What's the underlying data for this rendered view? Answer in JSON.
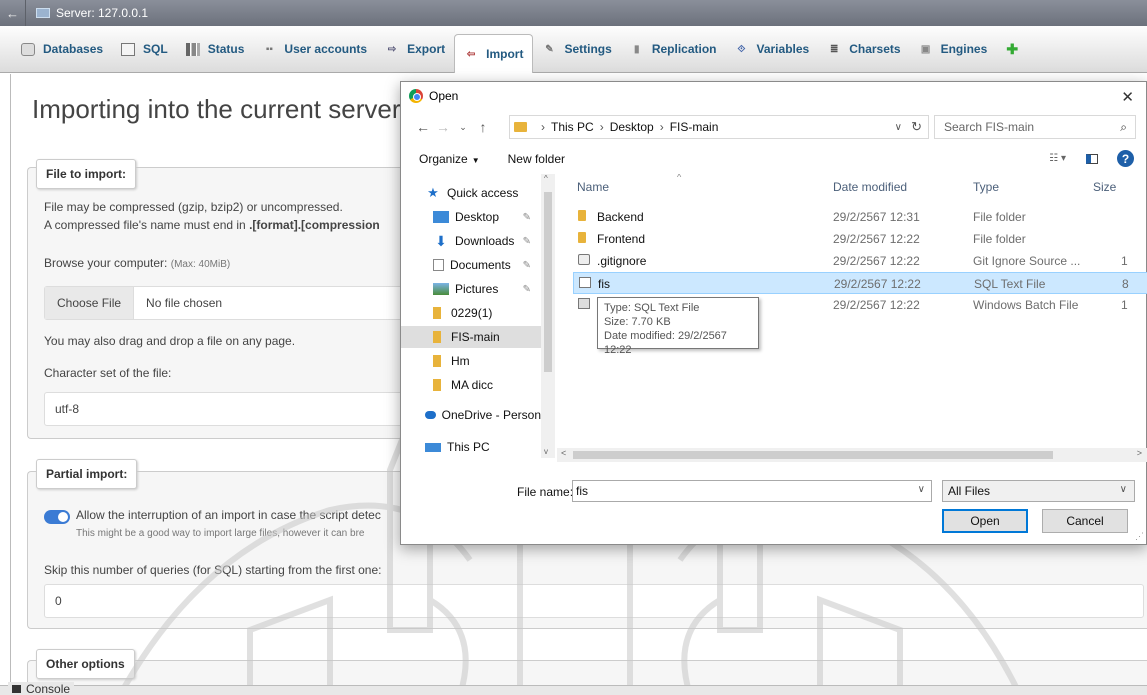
{
  "server_bar": {
    "title": "Server: 127.0.0.1"
  },
  "tabs": [
    {
      "label": "Databases",
      "icon": "database-icon"
    },
    {
      "label": "SQL",
      "icon": "sql-icon"
    },
    {
      "label": "Status",
      "icon": "status-icon"
    },
    {
      "label": "User accounts",
      "icon": "users-icon"
    },
    {
      "label": "Export",
      "icon": "export-icon"
    },
    {
      "label": "Import",
      "icon": "import-icon",
      "active": true
    },
    {
      "label": "Settings",
      "icon": "wrench-icon"
    },
    {
      "label": "Replication",
      "icon": "replication-icon"
    },
    {
      "label": "Variables",
      "icon": "variables-icon"
    },
    {
      "label": "Charsets",
      "icon": "charsets-icon"
    },
    {
      "label": "Engines",
      "icon": "engines-icon"
    }
  ],
  "main": {
    "title": "Importing into the current server",
    "file_import": {
      "legend": "File to import:",
      "line1": "File may be compressed (gzip, bzip2) or uncompressed.",
      "line2_prefix": "A compressed file's name must end in ",
      "line2_bold": ".[format].[compression",
      "browse_label": "Browse your computer:",
      "browse_max": "(Max: 40MiB)",
      "choose_button": "Choose File",
      "no_file": "No file chosen",
      "drag_text": "You may also drag and drop a file on any page.",
      "charset_label": "Character set of the file:",
      "charset_value": "utf-8"
    },
    "partial_import": {
      "legend": "Partial import:",
      "allow_text": "Allow the interruption of an import in case the script detec",
      "allow_hint": "This might be a good way to import large files, however it can bre",
      "skip_label": "Skip this number of queries (for SQL) starting from the first one:",
      "skip_value": "0"
    },
    "other_options": {
      "legend": "Other options"
    }
  },
  "console": {
    "label": "Console"
  },
  "dialog": {
    "title": "Open",
    "address": {
      "parts": [
        "This PC",
        "Desktop",
        "FIS-main"
      ]
    },
    "search_placeholder": "Search FIS-main",
    "organize": "Organize",
    "new_folder": "New folder",
    "nav": [
      {
        "label": "Quick access",
        "icon": "star-icon",
        "pinned": false
      },
      {
        "label": "Desktop",
        "icon": "desktop-icon",
        "pinned": true
      },
      {
        "label": "Downloads",
        "icon": "download-icon",
        "pinned": true
      },
      {
        "label": "Documents",
        "icon": "documents-icon",
        "pinned": true
      },
      {
        "label": "Pictures",
        "icon": "pictures-icon",
        "pinned": true
      },
      {
        "label": "0229(1)",
        "icon": "folder-icon",
        "pinned": false
      },
      {
        "label": "FIS-main",
        "icon": "folder-icon",
        "pinned": false,
        "selected": true
      },
      {
        "label": "Hm",
        "icon": "folder-icon",
        "pinned": false
      },
      {
        "label": "MA dicc",
        "icon": "folder-icon",
        "pinned": false
      },
      {
        "label": "OneDrive - Person",
        "icon": "cloud-icon",
        "pinned": false
      },
      {
        "label": "This PC",
        "icon": "computer-icon",
        "pinned": false
      }
    ],
    "columns": {
      "name": "Name",
      "date": "Date modified",
      "type": "Type",
      "size": "Size"
    },
    "files": [
      {
        "name": "Backend",
        "date": "29/2/2567 12:31",
        "type": "File folder",
        "size": "",
        "icon": "folder-icon"
      },
      {
        "name": "Frontend",
        "date": "29/2/2567 12:22",
        "type": "File folder",
        "size": "",
        "icon": "folder-icon"
      },
      {
        "name": ".gitignore",
        "date": "29/2/2567 12:22",
        "type": "Git Ignore Source ...",
        "size": "1",
        "icon": "gitignore-file-icon"
      },
      {
        "name": "fis",
        "date": "29/2/2567 12:22",
        "type": "SQL Text File",
        "size": "8",
        "icon": "sql-file-icon",
        "selected": true
      },
      {
        "name": "",
        "date": "29/2/2567 12:22",
        "type": "Windows Batch File",
        "size": "1",
        "icon": "batch-file-icon"
      }
    ],
    "tooltip": {
      "type": "Type: SQL Text File",
      "size": "Size: 7.70 KB",
      "date": "Date modified: 29/2/2567 12:22"
    },
    "file_name_label": "File name:",
    "file_name_value": "fis",
    "file_type": "All Files",
    "open_button": "Open",
    "cancel_button": "Cancel"
  }
}
